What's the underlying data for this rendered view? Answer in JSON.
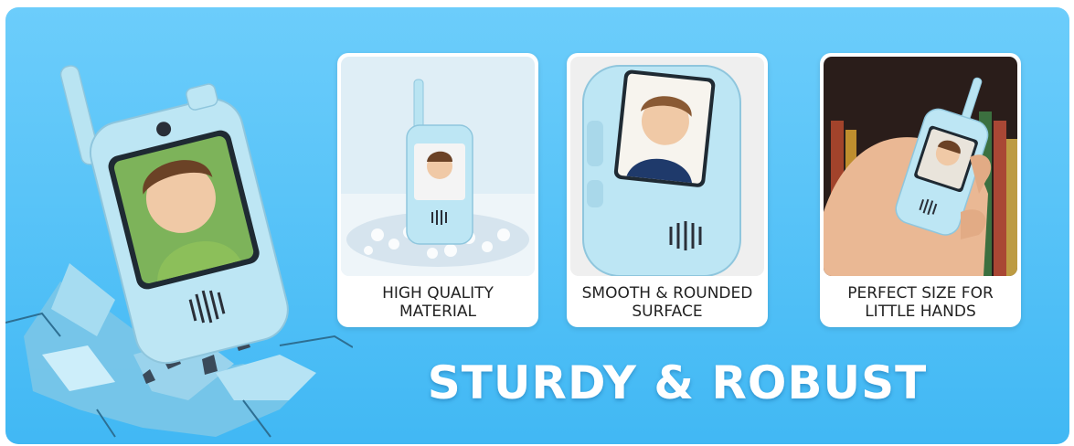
{
  "headline": "STURDY & ROBUST",
  "features": [
    {
      "caption": "HIGH QUALITY\nMATERIAL"
    },
    {
      "caption": "SMOOTH & ROUNDED\nSURFACE"
    },
    {
      "caption": "PERFECT SIZE FOR\nLITTLE HANDS"
    }
  ],
  "colors": {
    "background_top": "#6ccdfb",
    "background_bottom": "#41b8f4",
    "device_body": "#b9e4f2",
    "caption_text": "#222222",
    "headline_text": "#ffffff"
  },
  "icons": {
    "hero": "walkie-talkie-breaking-through-ground",
    "card1": "walkie-talkie-on-water-beads",
    "card2": "walkie-talkie-closeup",
    "card3": "walkie-talkie-in-hand"
  }
}
